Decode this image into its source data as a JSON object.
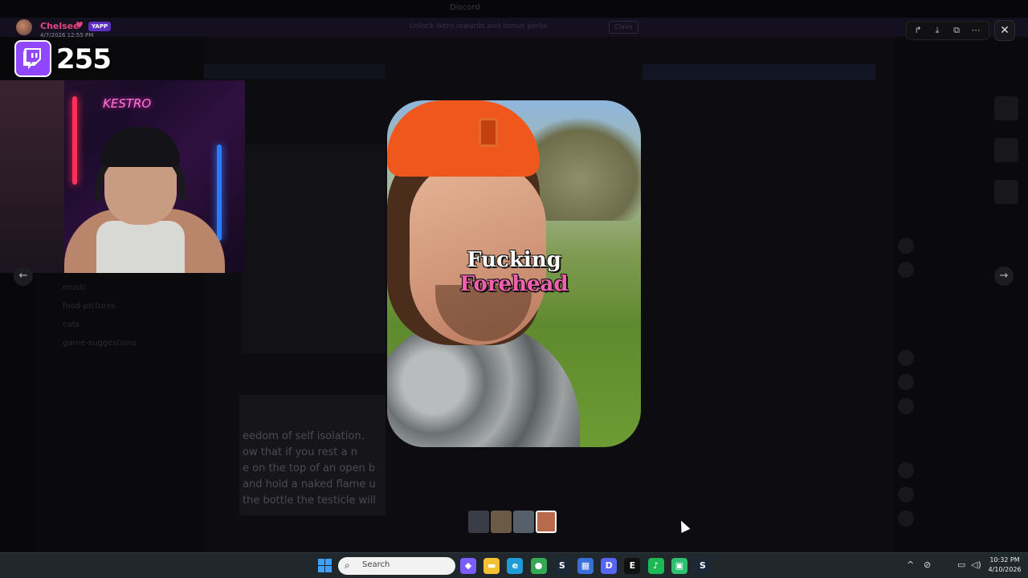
{
  "background_app": {
    "title": "Discord",
    "banner_text": "Unlock Nitro rewards and bonus perks",
    "banner_button": "Claim",
    "channels": [
      "music",
      "food-pictures",
      "cats",
      "game-suggestions"
    ],
    "document_lines": [
      "eedom of self isolation.",
      "ow that if you rest a n",
      "e on the top of an open b",
      "and hold a naked flame u",
      "the bottle the testicle will"
    ]
  },
  "stream_overlay": {
    "streamer_name": "Chelsee",
    "badge": "YAPP",
    "post_date": "4/7/2026 12:55 PM",
    "viewer_count": "255",
    "webcam_sign": "KESTRO"
  },
  "viewer": {
    "caption_line_1": "Fucking",
    "caption_line_2": "Forehead",
    "prev_arrow": "←",
    "next_arrow": "→",
    "thumbnails": [
      {
        "color": "#3a3d46",
        "active": false
      },
      {
        "color": "#6b5a46",
        "active": false
      },
      {
        "color": "#55606a",
        "active": false
      },
      {
        "color": "#b86a4a",
        "active": true
      }
    ]
  },
  "controls": {
    "forward_icon": "↱",
    "download_icon": "⤓",
    "open_external_icon": "⧉",
    "more_icon": "⋯",
    "close_icon": "✕"
  },
  "taskbar": {
    "search_placeholder": "Search",
    "apps": [
      {
        "name": "copilot",
        "glyph": "◆",
        "color": "#7a5cff"
      },
      {
        "name": "file-explorer",
        "glyph": "▬",
        "color": "#f2c230"
      },
      {
        "name": "edge",
        "glyph": "e",
        "color": "#1f9cd6"
      },
      {
        "name": "chrome",
        "glyph": "●",
        "color": "#34a853"
      },
      {
        "name": "steam",
        "glyph": "S",
        "color": "#1b2838"
      },
      {
        "name": "store",
        "glyph": "▦",
        "color": "#3a6fd8"
      },
      {
        "name": "discord",
        "glyph": "D",
        "color": "#5865f2"
      },
      {
        "name": "epic-games",
        "glyph": "E",
        "color": "#111"
      },
      {
        "name": "spotify",
        "glyph": "♪",
        "color": "#1db954"
      },
      {
        "name": "android",
        "glyph": "▣",
        "color": "#2fbf71"
      },
      {
        "name": "steam-2",
        "glyph": "S",
        "color": "#1b2838"
      }
    ],
    "time": "10:32 PM",
    "date": "4/10/2026"
  }
}
